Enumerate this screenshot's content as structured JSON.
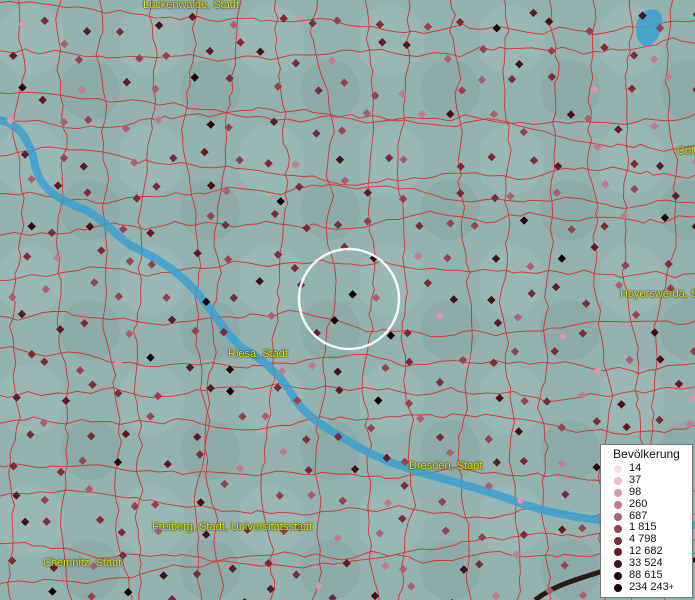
{
  "map": {
    "cities": [
      {
        "id": "luckenwalde",
        "label": "Luckenwalde, Stadt"
      },
      {
        "id": "cottbus",
        "label": "Cot"
      },
      {
        "id": "hoyerswerda",
        "label": "Hoyerswerda, S"
      },
      {
        "id": "riesa",
        "label": "Riesa, Stadt"
      },
      {
        "id": "dresden",
        "label": "Dresden, Stadt"
      },
      {
        "id": "freiberg",
        "label": "Freiberg, Stadt, Universitätsstadt"
      },
      {
        "id": "chemnitz",
        "label": "Chemnitz, Stadt"
      }
    ],
    "colors": {
      "background": "#8fb0ad",
      "boundary": "#e03030",
      "river": "#3aa0d0",
      "selection_circle": "#ffffff",
      "city_label": "#e6e600"
    }
  },
  "legend": {
    "title": "Bevölkerung",
    "items": [
      {
        "label": "14",
        "color": "#f7e1ea"
      },
      {
        "label": "37",
        "color": "#e9bccb"
      },
      {
        "label": "98",
        "color": "#d898ad"
      },
      {
        "label": "260",
        "color": "#c47a8f"
      },
      {
        "label": "687",
        "color": "#b05c72"
      },
      {
        "label": "1 815",
        "color": "#98404f"
      },
      {
        "label": "4 798",
        "color": "#7e2a38"
      },
      {
        "label": "12 682",
        "color": "#621a24"
      },
      {
        "label": "33 524",
        "color": "#461016"
      },
      {
        "label": "88 615",
        "color": "#2c080c"
      },
      {
        "label": "234 243",
        "color": "#140203"
      }
    ],
    "last_suffix": "+"
  }
}
